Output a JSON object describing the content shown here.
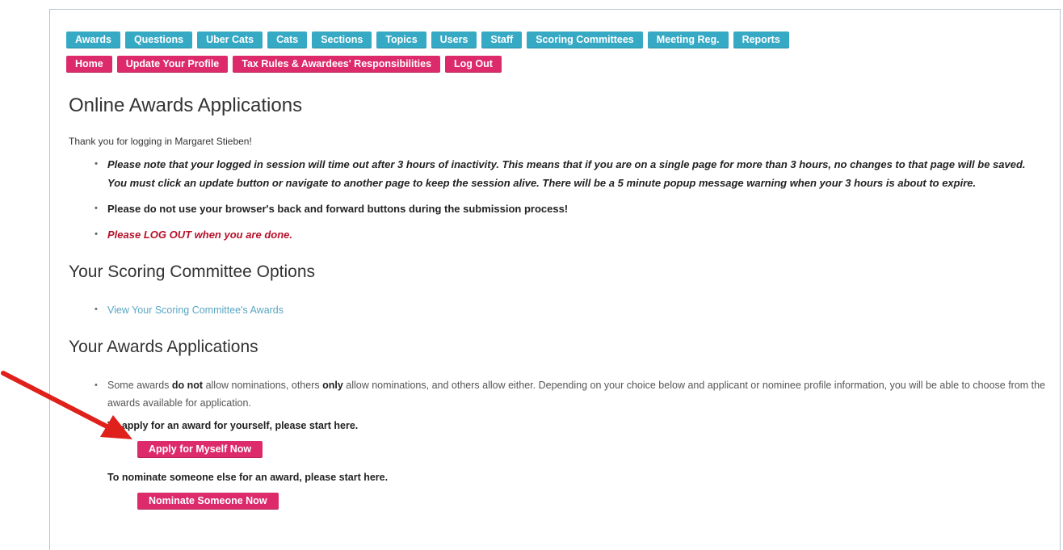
{
  "nav_primary": [
    {
      "label": "Awards"
    },
    {
      "label": "Questions"
    },
    {
      "label": "Uber Cats"
    },
    {
      "label": "Cats"
    },
    {
      "label": "Sections"
    },
    {
      "label": "Topics"
    },
    {
      "label": "Users"
    },
    {
      "label": "Staff"
    },
    {
      "label": "Scoring Committees"
    },
    {
      "label": "Meeting Reg."
    },
    {
      "label": "Reports"
    }
  ],
  "nav_secondary": [
    {
      "label": "Home"
    },
    {
      "label": "Update Your Profile"
    },
    {
      "label": "Tax Rules & Awardees' Responsibilities"
    },
    {
      "label": "Log Out"
    }
  ],
  "page_title": "Online Awards Applications",
  "greeting": "Thank you for logging in Margaret Stieben!",
  "notes": [
    "Please note that your logged in session will time out after 3 hours of inactivity. This means that if you are on a single page for more than 3 hours, no changes to that page will be saved. You must click an update button or navigate to another page to keep the session alive. There will be a 5 minute popup message warning when your 3 hours is about to expire.",
    "Please do not use your browser's back and forward buttons during the submission process!",
    "Please LOG OUT when you are done."
  ],
  "scoring": {
    "heading": "Your Scoring Committee Options",
    "link": "View Your Scoring Committee's Awards"
  },
  "applications": {
    "heading": "Your Awards Applications",
    "info_parts": [
      "Some awards ",
      "do not",
      " allow nominations, others ",
      "only",
      " allow nominations, and others allow either. Depending on your choice below and applicant or nominee profile information, you will be able to choose from the awards available for application."
    ],
    "self_prompt": "To apply for an award for yourself, please start here.",
    "self_button": "Apply for Myself Now",
    "nominate_prompt": "To nominate someone else for an award, please start here.",
    "nominate_button": "Nominate Someone Now"
  },
  "colors": {
    "nav_primary": "#36a9c4",
    "nav_secondary": "#dc2a6a",
    "warning_text": "#b8112b",
    "link": "#5aa6c2",
    "annotation_arrow": "#e0201b"
  }
}
